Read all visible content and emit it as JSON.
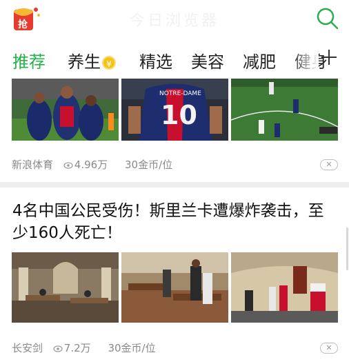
{
  "header": {
    "title": "今日浏览器",
    "logo_text": "抢",
    "search_icon": "search-icon",
    "accent_color": "#27b04a"
  },
  "tabs": [
    {
      "label": "推荐",
      "active": true
    },
    {
      "label": "养生",
      "badge": "¥"
    },
    {
      "label": "精选"
    },
    {
      "label": "美容"
    },
    {
      "label": "减肥"
    },
    {
      "label": "健身"
    }
  ],
  "add_tab_icon": "plus-icon",
  "articles": [
    {
      "headline": "",
      "source": "新浪体育",
      "views": "4.96万",
      "reward": "30金币/位",
      "images": [
        "psg-team-celebration",
        "psg-player-10-back",
        "football-match-play"
      ]
    },
    {
      "headline": "4名中国公民受伤！斯里兰卡遭爆炸袭击，至少160人死亡！",
      "source": "长安剑",
      "views": "7.2万",
      "reward": "30金币/位",
      "images": [
        "church-interior-damage",
        "church-debris-crowd",
        "church-aftermath-people"
      ]
    }
  ],
  "image_captions": {
    "jersey_text": "10",
    "jersey_name": "NOTRE-DAME"
  },
  "dismiss_icon": "close-icon"
}
